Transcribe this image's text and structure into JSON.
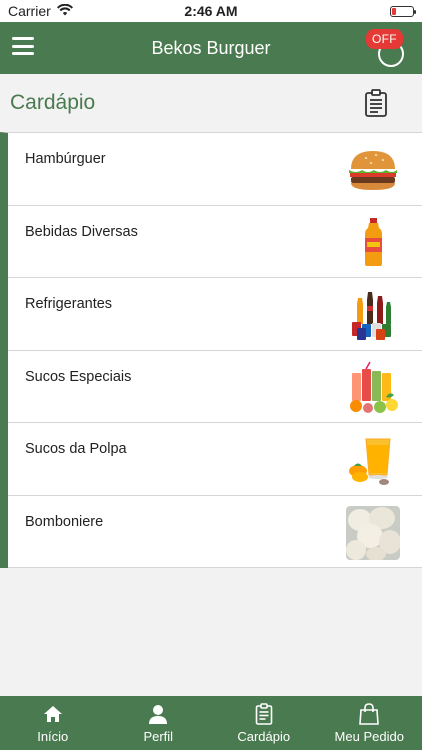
{
  "status_bar": {
    "carrier": "Carrier",
    "time": "2:46 AM"
  },
  "header": {
    "title": "Bekos Burguer",
    "status_badge": "OFF"
  },
  "page": {
    "title": "Cardápio"
  },
  "menu": {
    "items": [
      {
        "label": "Hambúrguer",
        "icon": "burger-image"
      },
      {
        "label": "Bebidas Diversas",
        "icon": "juice-bottle-image"
      },
      {
        "label": "Refrigerantes",
        "icon": "soft-drinks-image"
      },
      {
        "label": "Sucos Especiais",
        "icon": "fruit-juices-image"
      },
      {
        "label": "Sucos da Polpa",
        "icon": "pulp-juice-image"
      },
      {
        "label": "Bomboniere",
        "icon": "candy-image"
      }
    ]
  },
  "tabs": [
    {
      "label": "Início",
      "icon": "home-icon"
    },
    {
      "label": "Perfil",
      "icon": "user-icon"
    },
    {
      "label": "Cardápio",
      "icon": "clipboard-icon"
    },
    {
      "label": "Meu Pedido",
      "icon": "shopping-bag-icon"
    }
  ],
  "colors": {
    "primary": "#4a7a4f",
    "badge": "#e53935",
    "background": "#f2f2f2"
  }
}
